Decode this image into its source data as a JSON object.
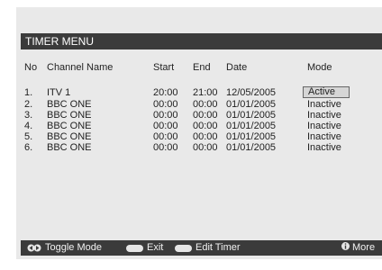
{
  "title": "TIMER MENU",
  "columns": {
    "no": "No",
    "channel": "Channel Name",
    "start": "Start",
    "end": "End",
    "date": "Date",
    "mode": "Mode"
  },
  "rows": [
    {
      "no": "1.",
      "channel": "ITV 1",
      "start": "20:00",
      "end": "21:00",
      "date": "12/05/2005",
      "mode": "Active"
    },
    {
      "no": "2.",
      "channel": "BBC ONE",
      "start": "00:00",
      "end": "00:00",
      "date": "01/01/2005",
      "mode": "Inactive"
    },
    {
      "no": "3.",
      "channel": "BBC ONE",
      "start": "00:00",
      "end": "00:00",
      "date": "01/01/2005",
      "mode": "Inactive"
    },
    {
      "no": "4.",
      "channel": "BBC ONE",
      "start": "00:00",
      "end": "00:00",
      "date": "01/01/2005",
      "mode": "Inactive"
    },
    {
      "no": "5.",
      "channel": "BBC ONE",
      "start": "00:00",
      "end": "00:00",
      "date": "01/01/2005",
      "mode": "Inactive"
    },
    {
      "no": "6.",
      "channel": "BBC ONE",
      "start": "00:00",
      "end": "00:00",
      "date": "01/01/2005",
      "mode": "Inactive"
    }
  ],
  "footer": {
    "toggle_label": "Toggle Mode",
    "exit_label": "Exit",
    "edit_label": "Edit Timer",
    "more_label": "More",
    "toggle_icon": "left-right-arrows-icon",
    "exit_icon": "menu-button-icon",
    "edit_icon": "select-button-icon",
    "more_icon": "info-icon"
  }
}
